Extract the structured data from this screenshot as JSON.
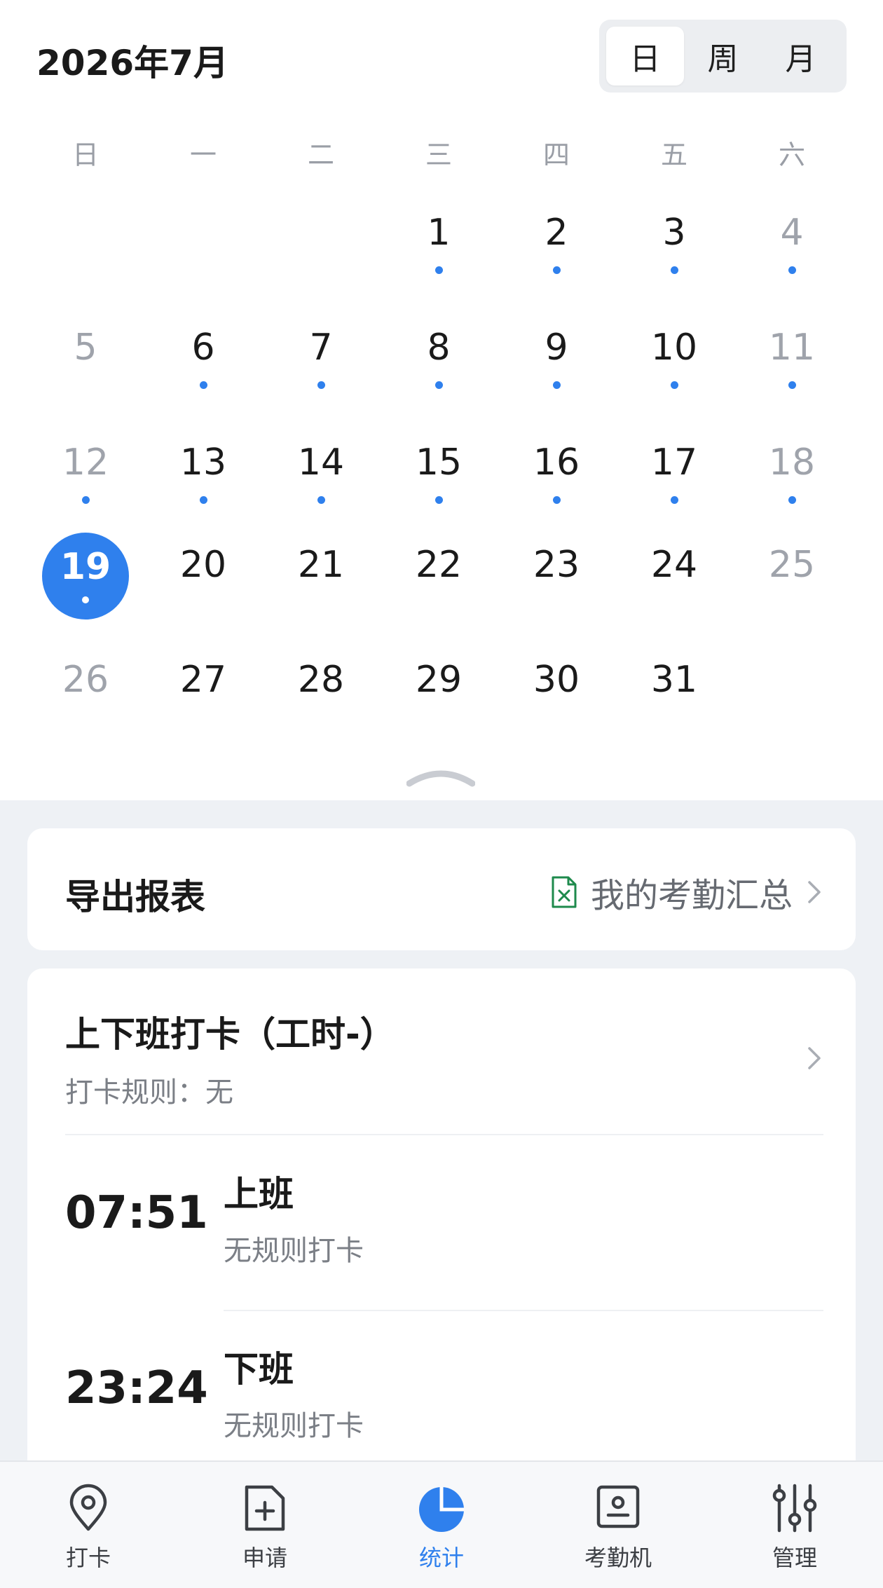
{
  "header": {
    "month_title": "2026年7月",
    "view_toggle": [
      {
        "label": "日",
        "active": true
      },
      {
        "label": "周",
        "active": false
      },
      {
        "label": "月",
        "active": false
      }
    ]
  },
  "calendar": {
    "weekdays": [
      "日",
      "一",
      "二",
      "三",
      "四",
      "五",
      "六"
    ],
    "weeks": [
      [
        null,
        null,
        null,
        {
          "day": "1",
          "dot": true
        },
        {
          "day": "2",
          "dot": true
        },
        {
          "day": "3",
          "dot": true
        },
        {
          "day": "4",
          "dot": true
        }
      ],
      [
        {
          "day": "5",
          "dot": false
        },
        {
          "day": "6",
          "dot": true
        },
        {
          "day": "7",
          "dot": true
        },
        {
          "day": "8",
          "dot": true
        },
        {
          "day": "9",
          "dot": true
        },
        {
          "day": "10",
          "dot": true
        },
        {
          "day": "11",
          "dot": true
        }
      ],
      [
        {
          "day": "12",
          "dot": true
        },
        {
          "day": "13",
          "dot": true
        },
        {
          "day": "14",
          "dot": true
        },
        {
          "day": "15",
          "dot": true
        },
        {
          "day": "16",
          "dot": true
        },
        {
          "day": "17",
          "dot": true
        },
        {
          "day": "18",
          "dot": true
        }
      ],
      [
        {
          "day": "19",
          "dot": true,
          "selected": true
        },
        {
          "day": "20",
          "dot": false
        },
        {
          "day": "21",
          "dot": false
        },
        {
          "day": "22",
          "dot": false
        },
        {
          "day": "23",
          "dot": false
        },
        {
          "day": "24",
          "dot": false
        },
        {
          "day": "25",
          "dot": false
        }
      ],
      [
        {
          "day": "26",
          "dot": false
        },
        {
          "day": "27",
          "dot": false
        },
        {
          "day": "28",
          "dot": false
        },
        {
          "day": "29",
          "dot": false
        },
        {
          "day": "30",
          "dot": false
        },
        {
          "day": "31",
          "dot": false
        },
        null
      ]
    ]
  },
  "export_card": {
    "title": "导出报表",
    "link_label": "我的考勤汇总",
    "link_icon": "excel-file-icon"
  },
  "attendance": {
    "title": "上下班打卡（工时-）",
    "rule": "打卡规则：无",
    "records": [
      {
        "time": "07:51",
        "label": "上班",
        "status": "无规则打卡"
      },
      {
        "time": "23:24",
        "label": "下班",
        "status": "无规则打卡"
      }
    ]
  },
  "tabbar": {
    "tabs": [
      {
        "label": "打卡",
        "icon": "location-pin-icon",
        "active": false
      },
      {
        "label": "申请",
        "icon": "add-document-icon",
        "active": false
      },
      {
        "label": "统计",
        "icon": "pie-chart-icon",
        "active": true
      },
      {
        "label": "考勤机",
        "icon": "attendance-machine-icon",
        "active": false
      },
      {
        "label": "管理",
        "icon": "sliders-icon",
        "active": false
      }
    ]
  },
  "colors": {
    "accent": "#2f80ed",
    "weekend_text": "#9fa3ab",
    "background": "#eef1f5",
    "excel_green": "#1e8a4c"
  }
}
